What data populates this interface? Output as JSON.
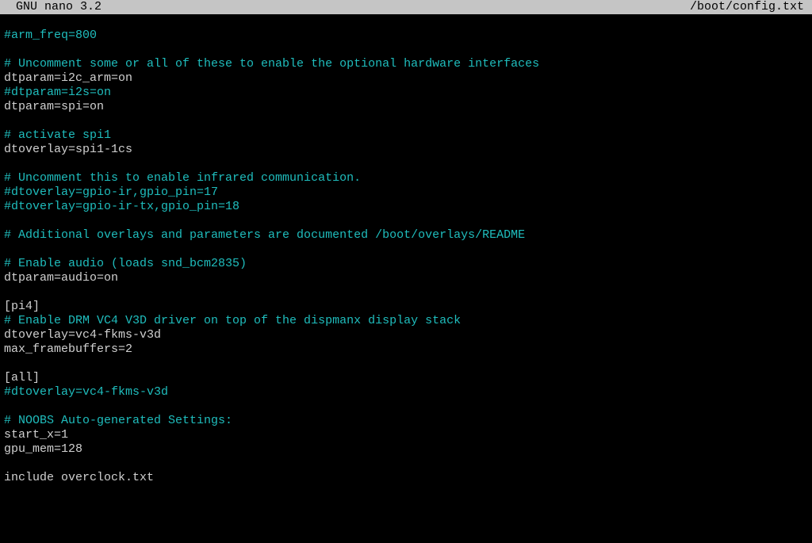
{
  "titlebar": {
    "app": "GNU nano 3.2",
    "filename": "/boot/config.txt"
  },
  "lines": [
    {
      "cls": "comment",
      "text": ""
    },
    {
      "cls": "comment",
      "text": "#arm_freq=800"
    },
    {
      "cls": "comment",
      "text": ""
    },
    {
      "cls": "comment",
      "text": "# Uncomment some or all of these to enable the optional hardware interfaces"
    },
    {
      "cls": "normal",
      "text": "dtparam=i2c_arm=on"
    },
    {
      "cls": "comment",
      "text": "#dtparam=i2s=on"
    },
    {
      "cls": "normal",
      "text": "dtparam=spi=on"
    },
    {
      "cls": "comment",
      "text": ""
    },
    {
      "cls": "comment",
      "text": "# activate spi1"
    },
    {
      "cls": "normal",
      "text": "dtoverlay=spi1-1cs"
    },
    {
      "cls": "comment",
      "text": ""
    },
    {
      "cls": "comment",
      "text": "# Uncomment this to enable infrared communication."
    },
    {
      "cls": "comment",
      "text": "#dtoverlay=gpio-ir,gpio_pin=17"
    },
    {
      "cls": "comment",
      "text": "#dtoverlay=gpio-ir-tx,gpio_pin=18"
    },
    {
      "cls": "comment",
      "text": ""
    },
    {
      "cls": "comment",
      "text": "# Additional overlays and parameters are documented /boot/overlays/README"
    },
    {
      "cls": "comment",
      "text": ""
    },
    {
      "cls": "comment",
      "text": "# Enable audio (loads snd_bcm2835)"
    },
    {
      "cls": "normal",
      "text": "dtparam=audio=on"
    },
    {
      "cls": "comment",
      "text": ""
    },
    {
      "cls": "normal",
      "text": "[pi4]"
    },
    {
      "cls": "comment",
      "text": "# Enable DRM VC4 V3D driver on top of the dispmanx display stack"
    },
    {
      "cls": "normal",
      "text": "dtoverlay=vc4-fkms-v3d"
    },
    {
      "cls": "normal",
      "text": "max_framebuffers=2"
    },
    {
      "cls": "comment",
      "text": ""
    },
    {
      "cls": "normal",
      "text": "[all]"
    },
    {
      "cls": "comment",
      "text": "#dtoverlay=vc4-fkms-v3d"
    },
    {
      "cls": "comment",
      "text": ""
    },
    {
      "cls": "comment",
      "text": "# NOOBS Auto-generated Settings:"
    },
    {
      "cls": "normal",
      "text": "start_x=1"
    },
    {
      "cls": "normal",
      "text": "gpu_mem=128"
    },
    {
      "cls": "comment",
      "text": ""
    },
    {
      "cls": "normal",
      "text": "include overclock.txt"
    }
  ]
}
